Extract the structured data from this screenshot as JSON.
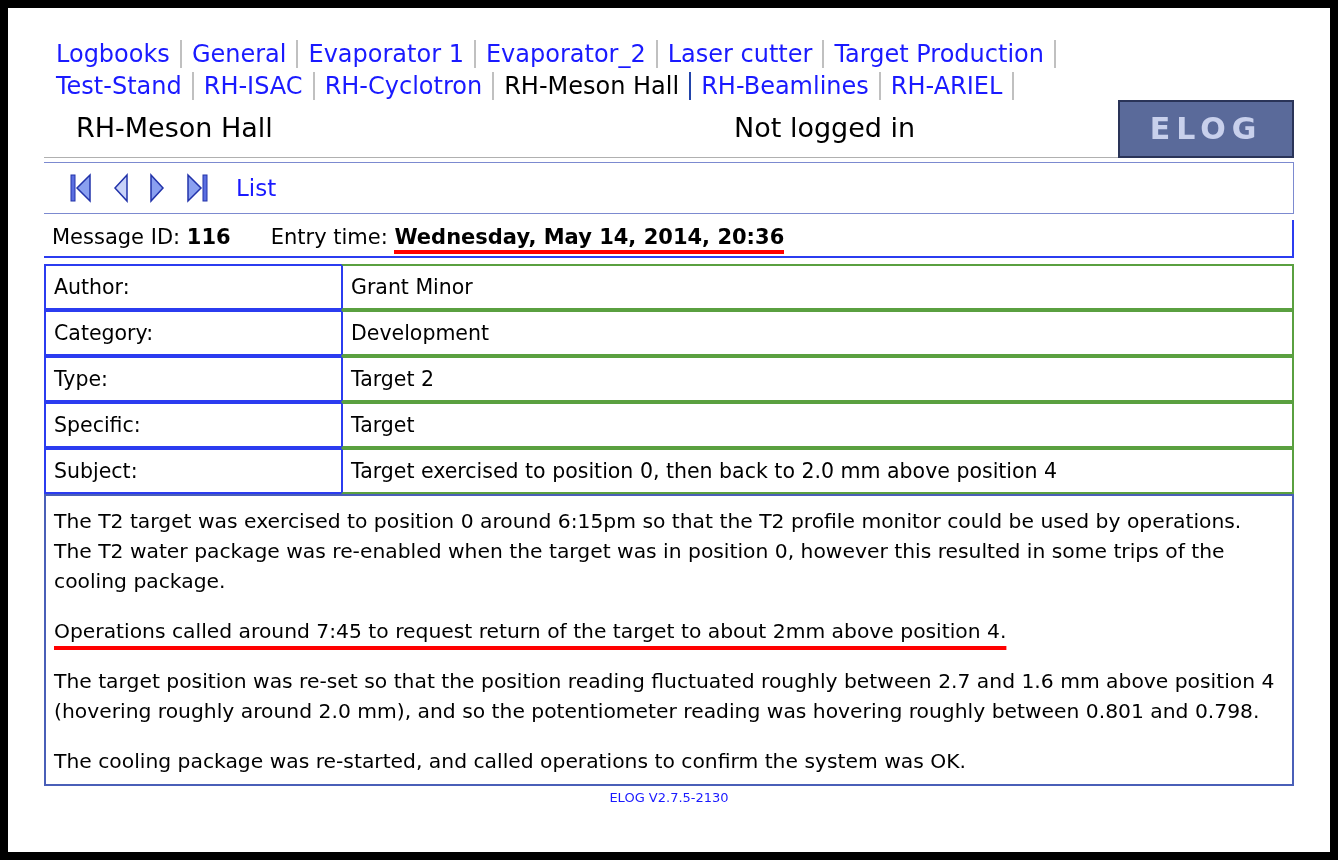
{
  "tab_rows": [
    [
      {
        "label": "Logbooks",
        "selected": false
      },
      {
        "label": "General",
        "selected": false
      },
      {
        "label": "Evaporator 1",
        "selected": false
      },
      {
        "label": "Evaporator_2",
        "selected": false
      },
      {
        "label": "Laser cutter",
        "selected": false
      },
      {
        "label": "Target Production",
        "selected": false
      }
    ],
    [
      {
        "label": "Test-Stand",
        "selected": false
      },
      {
        "label": "RH-ISAC",
        "selected": false
      },
      {
        "label": "RH-Cyclotron",
        "selected": false
      },
      {
        "label": "RH-Meson Hall",
        "selected": true
      },
      {
        "label": "RH-Beamlines",
        "selected": false
      },
      {
        "label": "RH-ARIEL",
        "selected": false
      }
    ]
  ],
  "header": {
    "title": "RH-Meson Hall",
    "login_status": "Not logged in",
    "logo": "ELOG"
  },
  "nav": {
    "link": "List"
  },
  "message": {
    "id_label": "Message ID:",
    "id": "116",
    "time_label": "Entry time:",
    "time": "Wednesday, May 14, 2014, 20:36",
    "underlined": true
  },
  "attributes": [
    {
      "label": "Author:",
      "value": "Grant Minor"
    },
    {
      "label": "Category:",
      "value": "Development"
    },
    {
      "label": "Type:",
      "value": "Target 2"
    },
    {
      "label": "Specific:",
      "value": "Target"
    },
    {
      "label": "Subject:",
      "value": "Target exercised to position 0, then back to 2.0 mm above position 4"
    }
  ],
  "body": [
    {
      "text": "The T2 target was exercised to position 0 around 6:15pm so that the T2 profile monitor could be used by operations.  The T2 water package was re-enabled when the target was in position 0, however this resulted in some trips of the cooling package.",
      "underlined": false
    },
    {
      "text": "Operations called around 7:45 to request return of the target to about 2mm above position 4.",
      "underlined": true
    },
    {
      "text": "The target position was re-set so that the position reading fluctuated roughly between 2.7 and 1.6 mm above position 4 (hovering roughly around 2.0 mm), and so the potentiometer reading was hovering roughly between 0.801 and 0.798.",
      "underlined": false
    },
    {
      "text": "The cooling package was re-started, and called operations to confirm the system was OK.",
      "underlined": false
    }
  ],
  "footer": "ELOG V2.7.5-2130"
}
